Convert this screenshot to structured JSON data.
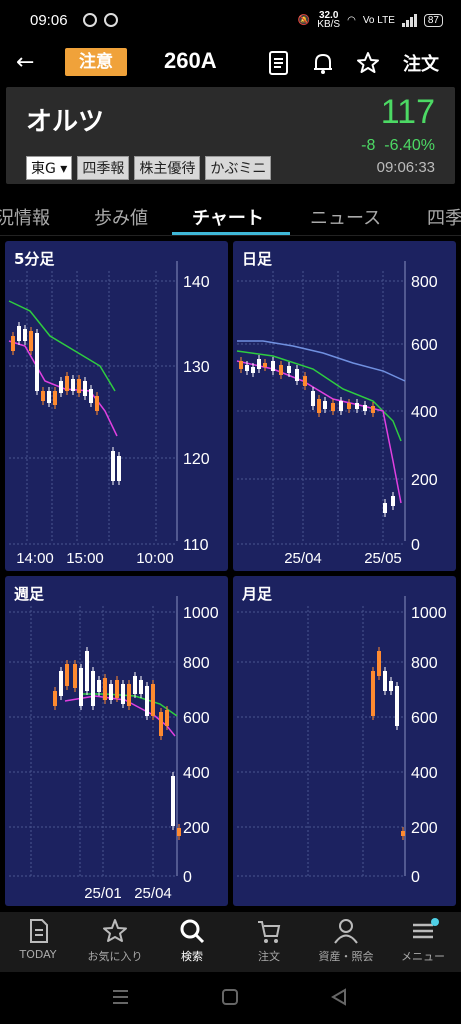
{
  "status_bar": {
    "time": "09:06",
    "net_speed": "32.0",
    "net_unit": "KB/S",
    "lte": "Vo LTE",
    "battery": "87"
  },
  "header": {
    "caution_label": "注意",
    "code": "260A",
    "order_label": "注文"
  },
  "quote": {
    "name": "オルツ",
    "price": "117",
    "change": "-8",
    "change_pct": "-6.40%",
    "time": "09:06:33",
    "price_color": "#4cd964",
    "tags": [
      "東G ▾",
      "四季報",
      "株主優待",
      "かぶミニ"
    ]
  },
  "tabs": [
    {
      "label": "況情報"
    },
    {
      "label": "歩み値"
    },
    {
      "label": "チャート",
      "active": true
    },
    {
      "label": "ニュース"
    },
    {
      "label": "四季"
    }
  ],
  "charts": [
    {
      "title": "5分足",
      "y_ticks": [
        "140",
        "130",
        "120",
        "110"
      ],
      "x_ticks": [
        "14:00",
        "15:00",
        "10:00"
      ]
    },
    {
      "title": "日足",
      "y_ticks": [
        "800",
        "600",
        "400",
        "200",
        "0"
      ],
      "x_ticks": [
        "25/04",
        "25/05"
      ]
    },
    {
      "title": "週足",
      "y_ticks": [
        "1000",
        "800",
        "600",
        "400",
        "200",
        "0"
      ],
      "x_ticks": [
        "25/01",
        "25/04"
      ]
    },
    {
      "title": "月足",
      "y_ticks": [
        "1000",
        "800",
        "600",
        "400",
        "200",
        "0"
      ],
      "x_ticks": []
    }
  ],
  "bottom_nav": [
    {
      "label": "TODAY",
      "icon": "document-icon"
    },
    {
      "label": "お気に入り",
      "icon": "star-icon"
    },
    {
      "label": "検索",
      "icon": "search-icon",
      "active": true
    },
    {
      "label": "注文",
      "icon": "cart-icon"
    },
    {
      "label": "資産・照会",
      "icon": "person-icon"
    },
    {
      "label": "メニュー",
      "icon": "menu-icon"
    }
  ],
  "colors": {
    "accent": "#3fb8d8",
    "up": "#ff8a30",
    "down": "#ffffff",
    "panel": "#1c2260",
    "caution": "#f0a23a"
  }
}
